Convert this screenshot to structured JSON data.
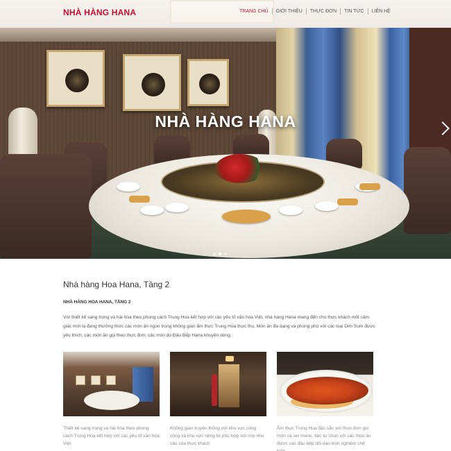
{
  "brand": {
    "logo_text": "NHÀ HÀNG HANA",
    "accent_color": "#c8102e"
  },
  "nav": {
    "items": [
      {
        "label": "TRANG CHỦ",
        "active": true
      },
      {
        "label": "GIỚI THIỆU",
        "active": false
      },
      {
        "label": "THỰC ĐƠN",
        "active": false
      },
      {
        "label": "TIN TỨC",
        "active": false
      },
      {
        "label": "LIÊN HỆ",
        "active": false
      }
    ]
  },
  "hero": {
    "title": "NHÀ HÀNG HANA",
    "next_icon": "chevron-right-icon",
    "slide_count": 3,
    "active_slide": 2
  },
  "section": {
    "heading": "Nhà hàng Hoa Hana, Tầng 2",
    "subheading": "NHÀ HÀNG HOA HANA, TẦNG 2",
    "intro": "Với thiết kế sang trọng và hài hòa theo phong cách Trung Hoa kết hợp với các yếu tố văn hóa Việt, nhà hàng Hana mang đến cho thực khách một cảm giác mới lạ đang thưởng thức các món ăn ngon trong không gian ẩm thực Trung Hoa thực thụ. Món ăn đa dạng và phong phú với các loại Dim Sum được yêu thích, các món ăn gọi theo thực đơn, các món do Đầu Bếp Hana khuyên dùng."
  },
  "gallery": [
    {
      "caption": "Thiết kế sang trọng và hài hòa theo phong cách Trung Hoa kết hợp với các yếu tố văn hóa Việt"
    },
    {
      "caption": "Không gian truyền thống với khu vực công cộng và khu vực riêng tư phù hợp với mọi nhu cầu của thực khách"
    },
    {
      "caption": "Ẩm thực Trung Hoa đặc sắc với thực đơn gọi món và set menu, tiệc tự chọn với các món ăn được các đầu bếp dồi dào kinh nghiệm chế biến"
    }
  ]
}
